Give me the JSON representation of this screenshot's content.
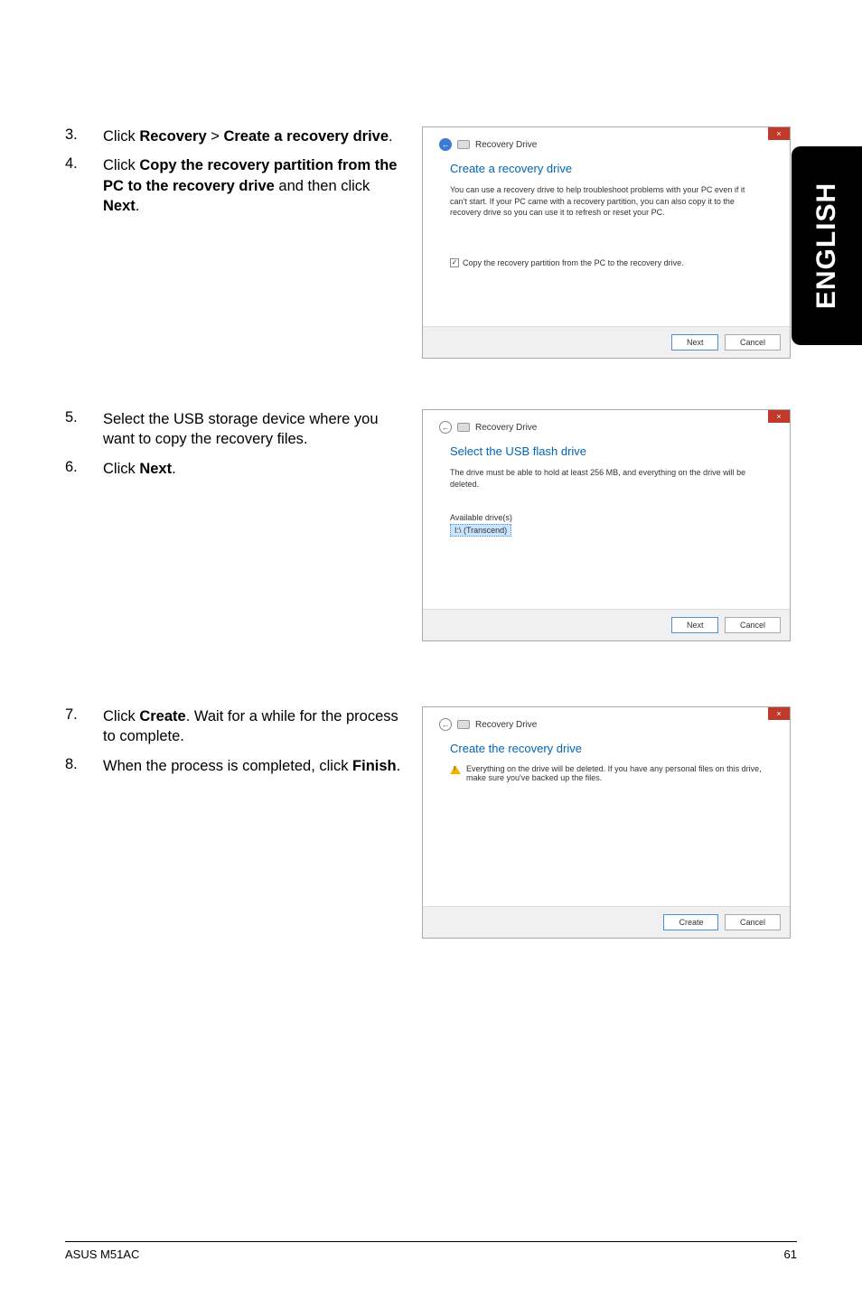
{
  "side_label": "ENGLISH",
  "group1": {
    "step3": {
      "num": "3.",
      "text_before": "Click ",
      "bold1": "Recovery",
      "mid": " > ",
      "bold2": "Create a recovery drive",
      "after": "."
    },
    "step4": {
      "num": "4.",
      "text_before": "Click ",
      "bold1": "Copy the recovery partition from the PC to the recovery drive",
      "mid": " and then click ",
      "bold2": "Next",
      "after": "."
    },
    "dialog": {
      "breadcrumb": "Recovery Drive",
      "heading": "Create a recovery drive",
      "desc": "You can use a recovery drive to help troubleshoot problems with your PC even if it can't start. If your PC came with a recovery partition, you can also copy it to the recovery drive so you can use it to refresh or reset your PC.",
      "checkbox_label": "Copy the recovery partition from the PC to the recovery drive.",
      "btn_next": "Next",
      "btn_cancel": "Cancel"
    }
  },
  "group2": {
    "step5": {
      "num": "5.",
      "text": "Select the USB storage device where you want to copy the recovery files."
    },
    "step6": {
      "num": "6.",
      "text_before": "Click ",
      "bold1": "Next",
      "after": "."
    },
    "dialog": {
      "breadcrumb": "Recovery Drive",
      "heading": "Select the USB flash drive",
      "desc": "The drive must be able to hold at least 256 MB, and everything on the drive will be deleted.",
      "list_label": "Available drive(s)",
      "drive_item": "I:\\ (Transcend)",
      "btn_next": "Next",
      "btn_cancel": "Cancel"
    }
  },
  "group3": {
    "step7": {
      "num": "7.",
      "text_before": "Click ",
      "bold1": "Create",
      "after": ". Wait for a while for the process to complete."
    },
    "step8": {
      "num": "8.",
      "text_before": "When the process is completed, click ",
      "bold1": "Finish",
      "after": "."
    },
    "dialog": {
      "breadcrumb": "Recovery Drive",
      "heading": "Create the recovery drive",
      "warn": "Everything on the drive will be deleted. If you have any personal files on this drive, make sure you've backed up the files.",
      "btn_create": "Create",
      "btn_cancel": "Cancel"
    }
  },
  "footer": {
    "left": "ASUS M51AC",
    "right": "61"
  }
}
